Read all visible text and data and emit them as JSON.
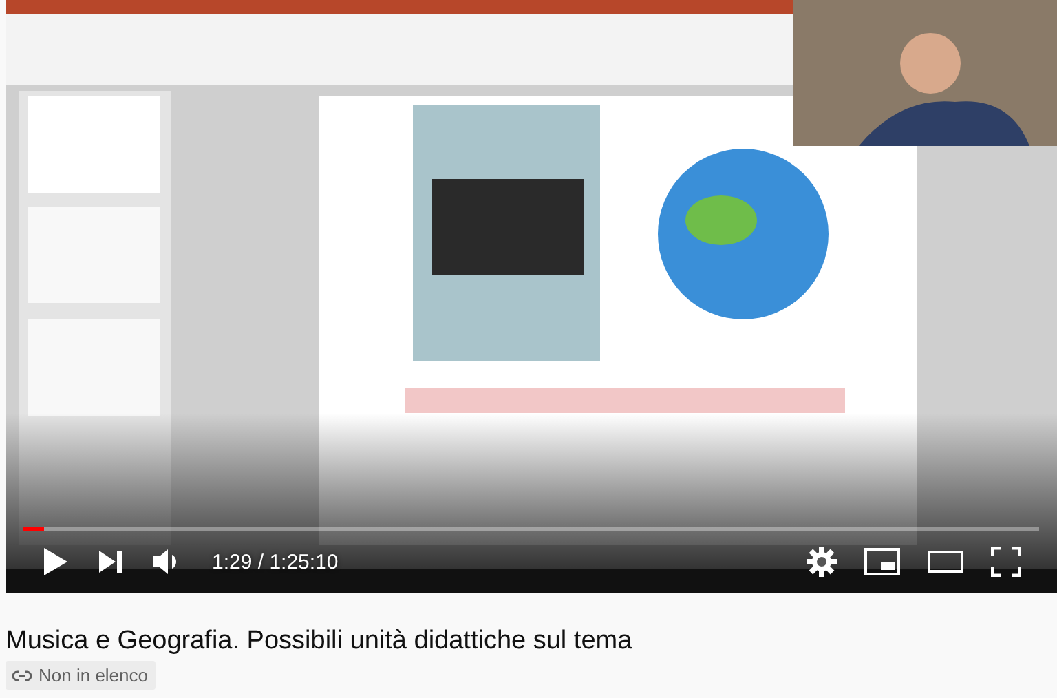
{
  "player": {
    "playing": false,
    "progress": {
      "level": 0.02
    },
    "time": "1:29 / 1:25:10"
  },
  "video": {
    "title": "Musica e Geografia. Possibili unità didattiche sul tema",
    "visibility": "Non in elenco"
  }
}
